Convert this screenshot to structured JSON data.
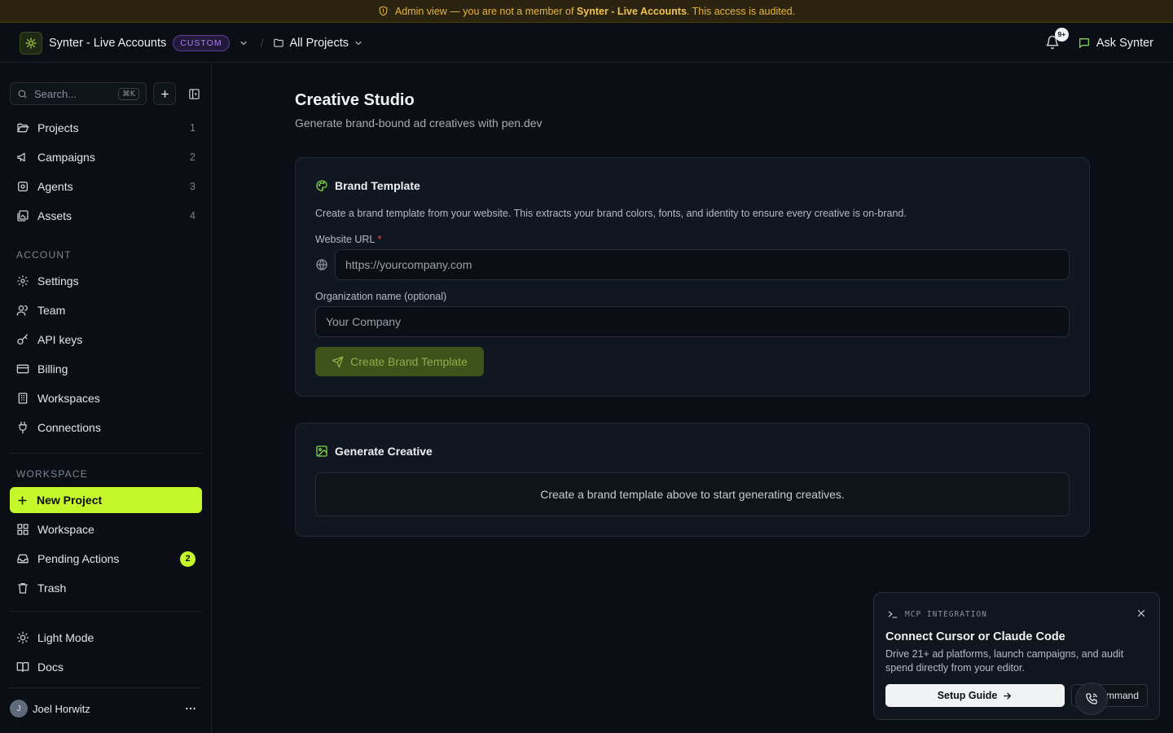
{
  "banner": {
    "prefix": "Admin view — you are not a member of ",
    "org": "Synter - Live Accounts",
    "suffix": ". This access is audited."
  },
  "header": {
    "org_name": "Synter - Live Accounts",
    "badge": "CUSTOM",
    "projects_label": "All Projects",
    "notif_badge": "9+",
    "ask_label": "Ask Synter"
  },
  "sidebar": {
    "search_placeholder": "Search...",
    "search_shortcut": "⌘K",
    "main_items": [
      {
        "label": "Projects",
        "count": "1"
      },
      {
        "label": "Campaigns",
        "count": "2"
      },
      {
        "label": "Agents",
        "count": "3"
      },
      {
        "label": "Assets",
        "count": "4"
      }
    ],
    "account_label": "ACCOUNT",
    "account_items": [
      {
        "label": "Settings"
      },
      {
        "label": "Team"
      },
      {
        "label": "API keys"
      },
      {
        "label": "Billing"
      },
      {
        "label": "Workspaces"
      },
      {
        "label": "Connections"
      }
    ],
    "workspace_label": "WORKSPACE",
    "workspace_items": [
      {
        "label": "New Project"
      },
      {
        "label": "Workspace"
      },
      {
        "label": "Pending Actions",
        "badge": "2"
      },
      {
        "label": "Trash"
      }
    ],
    "footer_items": [
      {
        "label": "Light Mode"
      },
      {
        "label": "Docs"
      }
    ],
    "user_name": "Joel Horwitz",
    "user_initial": "J"
  },
  "main": {
    "title": "Creative Studio",
    "subtitle": "Generate brand-bound ad creatives with pen.dev",
    "brand_card": {
      "title": "Brand Template",
      "description": "Create a brand template from your website. This extracts your brand colors, fonts, and identity to ensure every creative is on-brand.",
      "url_label": "Website URL",
      "url_required": "*",
      "url_placeholder": "https://yourcompany.com",
      "org_label": "Organization name (optional)",
      "org_placeholder": "Your Company",
      "button": "Create Brand Template"
    },
    "generate_card": {
      "title": "Generate Creative",
      "empty_text": "Create a brand template above to start generating creatives."
    }
  },
  "mcp": {
    "tag": "MCP INTEGRATION",
    "title": "Connect Cursor or Claude Code",
    "description": "Drive 21+ ad platforms, launch campaigns, and audit spend directly from your editor.",
    "setup_button": "Setup Guide",
    "command_button": "mmand"
  },
  "colors": {
    "accent": "#c5f82a",
    "background": "#0b0f15",
    "banner_text": "#e7b53a",
    "badge_purple": "#a77cf0"
  }
}
